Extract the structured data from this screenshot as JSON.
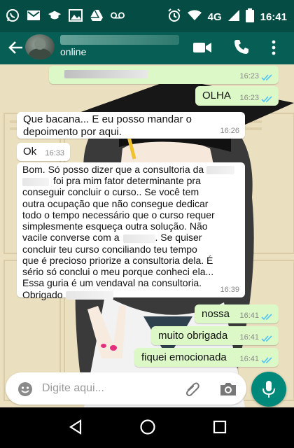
{
  "status_bar": {
    "network": "4G",
    "time": "16:41"
  },
  "header": {
    "contact_name": "",
    "contact_status": "online"
  },
  "messages": [
    {
      "id": "m1",
      "direction": "out",
      "text": "",
      "time": "16:23",
      "read": true
    },
    {
      "id": "m2",
      "direction": "out",
      "text": "OLHA",
      "time": "16:23",
      "read": true
    },
    {
      "id": "m3",
      "direction": "in",
      "text": "Que bacana... E eu posso mandar o depoimento por aqui.",
      "time": "16:26"
    },
    {
      "id": "m4",
      "direction": "in",
      "text": "Ok",
      "time": "16:33"
    },
    {
      "id": "m5",
      "direction": "in",
      "lines": [
        "Bom. Só posso dizer que a consultoria da",
        "foi pra mim fator determinante pra",
        "conseguir concluir o curso.. Se você tem",
        "outra ocupação que não consegue dedicar",
        "todo o tempo necessário que o curso requer",
        "simplesmente esqueça outra solução. Não",
        "vacile converse com a",
        ". Se quiser",
        "concluir teu curso conciliando teu tempo",
        "que é precioso priorize a consultoria dela. É",
        "sério só conclui o meu porque conheci ela...",
        "Essa guria é um vendaval na consultoria.",
        "Obrigado"
      ],
      "time": "16:39"
    },
    {
      "id": "m6",
      "direction": "out",
      "text": "nossa",
      "time": "16:41",
      "read": true
    },
    {
      "id": "m7",
      "direction": "out",
      "text": "muito obrigada",
      "time": "16:41",
      "read": true
    },
    {
      "id": "m8",
      "direction": "out",
      "text": "fiquei emocionada",
      "time": "16:41",
      "read": true
    }
  ],
  "input": {
    "placeholder": "Digite aqui..."
  },
  "colors": {
    "header": "#075e54",
    "status_bar": "#054d44",
    "outgoing_bubble": "#dcf8c6",
    "incoming_bubble": "#ffffff",
    "read_ticks": "#4fc3f7",
    "accent": "#00897b"
  },
  "icons": {
    "status_bar": [
      "whatsapp-icon",
      "mail-icon",
      "graduation-cap-icon",
      "gallery-icon",
      "drive-icon",
      "voicemail-icon",
      "alarm-icon",
      "wifi-icon",
      "signal-icon",
      "battery-icon"
    ],
    "header": [
      "back-arrow-icon",
      "video-call-icon",
      "phone-icon",
      "more-vert-icon"
    ],
    "input_bar": [
      "emoji-icon",
      "attach-icon",
      "camera-icon",
      "mic-icon"
    ],
    "nav_bar": [
      "nav-back-icon",
      "nav-home-icon",
      "nav-recent-icon"
    ]
  }
}
